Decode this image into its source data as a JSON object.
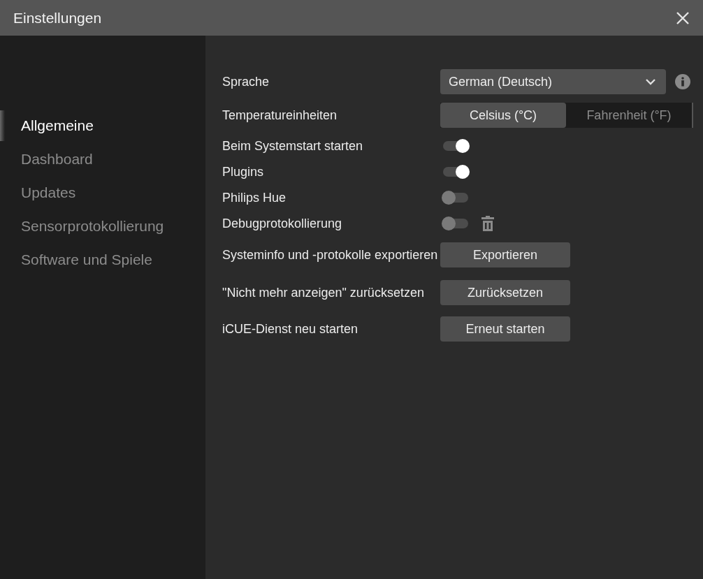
{
  "window": {
    "title": "Einstellungen"
  },
  "sidebar": {
    "items": [
      {
        "label": "Allgemeine",
        "selected": true
      },
      {
        "label": "Dashboard",
        "selected": false
      },
      {
        "label": "Updates",
        "selected": false
      },
      {
        "label": "Sensorprotokollierung",
        "selected": false
      },
      {
        "label": "Software und Spiele",
        "selected": false
      }
    ]
  },
  "settings": [
    {
      "kind": "dropdown",
      "label": "Sprache",
      "value": "German (Deutsch)"
    },
    {
      "kind": "segmented",
      "label": "Temperatureinheiten",
      "options": [
        {
          "label": "Celsius (°C)",
          "selected": true
        },
        {
          "label": "Fahrenheit (°F)",
          "selected": false
        }
      ]
    },
    {
      "kind": "toggle",
      "label": "Beim Systemstart starten",
      "on": true
    },
    {
      "kind": "toggle",
      "label": "Plugins",
      "on": true
    },
    {
      "kind": "toggle",
      "label": "Philips Hue",
      "on": false
    },
    {
      "kind": "toggle_delete",
      "label": "Debugprotokollierung",
      "on": false
    },
    {
      "kind": "button",
      "label": "Systeminfo und -protokolle exportieren",
      "button": "Exportieren"
    },
    {
      "kind": "button",
      "label": "\"Nicht mehr anzeigen\" zurücksetzen",
      "button": "Zurücksetzen"
    },
    {
      "kind": "button",
      "label": "iCUE-Dienst neu starten",
      "button": "Erneut starten"
    }
  ]
}
